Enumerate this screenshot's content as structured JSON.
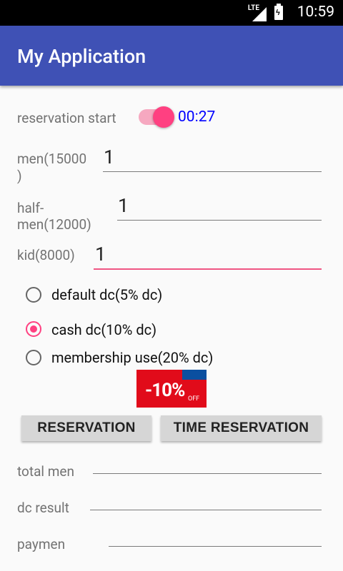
{
  "status_bar": {
    "time": "10:59",
    "network": "LTE",
    "battery_icon": "battery-charging-icon",
    "signal_icon": "cell-signal-icon"
  },
  "app_bar": {
    "title": "My Application",
    "color": "#3f51b5"
  },
  "reservation": {
    "label": "reservation start",
    "switch_on": true,
    "timer": "00:27",
    "accent": "#ff4081"
  },
  "fields": {
    "men": {
      "label_line1": "men(15000",
      "label_line2": ")",
      "value": "1"
    },
    "half_men": {
      "label_line1": "half-",
      "label_line2": "men(12000)",
      "value": "1"
    },
    "kid": {
      "label": "kid(8000)",
      "value": "1"
    }
  },
  "discounts": {
    "selected": "cash",
    "options": [
      {
        "label": "default dc(5% dc)"
      },
      {
        "label": "cash dc(10% dc)"
      },
      {
        "label": "membership use(20% dc)"
      }
    ]
  },
  "banner": {
    "text": "-10%",
    "sub": "OFF"
  },
  "buttons": {
    "reservation": "RESERVATION",
    "time_reservation": "TIME RESERVATION"
  },
  "results": {
    "total_men": {
      "label": "total men",
      "value": ""
    },
    "dc_result": {
      "label": "dc result",
      "value": ""
    },
    "payment": {
      "label": "paymen",
      "value": ""
    }
  }
}
